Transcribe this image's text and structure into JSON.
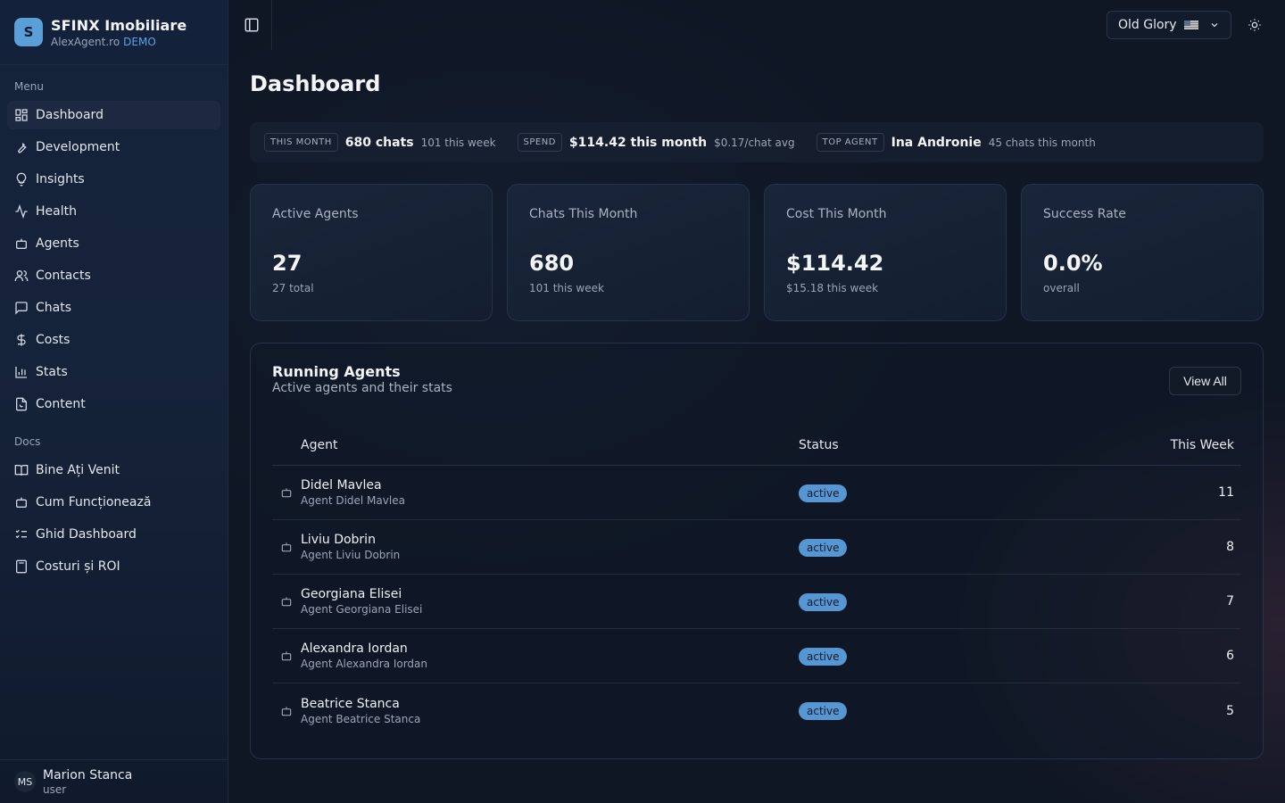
{
  "brand": {
    "initial": "S",
    "name": "SFINX Imobiliare",
    "domain": "AlexAgent.ro",
    "badge": "DEMO"
  },
  "menu": {
    "label": "Menu",
    "items": [
      {
        "label": "Dashboard",
        "icon": "dashboard-icon",
        "active": true
      },
      {
        "label": "Development",
        "icon": "wrench-icon"
      },
      {
        "label": "Insights",
        "icon": "lightbulb-icon"
      },
      {
        "label": "Health",
        "icon": "activity-icon"
      },
      {
        "label": "Agents",
        "icon": "bot-icon"
      },
      {
        "label": "Contacts",
        "icon": "users-icon"
      },
      {
        "label": "Chats",
        "icon": "message-icon"
      },
      {
        "label": "Costs",
        "icon": "dollar-icon"
      },
      {
        "label": "Stats",
        "icon": "bar-chart-icon"
      },
      {
        "label": "Content",
        "icon": "file-icon"
      }
    ]
  },
  "docs": {
    "label": "Docs",
    "items": [
      {
        "label": "Bine Ați Venit",
        "icon": "book-icon"
      },
      {
        "label": "Cum Funcționează",
        "icon": "bot-icon"
      },
      {
        "label": "Ghid Dashboard",
        "icon": "list-checks-icon"
      },
      {
        "label": "Costuri și ROI",
        "icon": "calculator-icon"
      }
    ]
  },
  "user": {
    "initials": "MS",
    "name": "Marion Stanca",
    "role": "user"
  },
  "topbar": {
    "theme": "Old Glory",
    "theme_icon": "flag-icon"
  },
  "page": {
    "title": "Dashboard"
  },
  "summary": {
    "month": {
      "tag": "THIS MONTH",
      "main": "680 chats",
      "sub": "101 this week"
    },
    "spend": {
      "tag": "SPEND",
      "main": "$114.42 this month",
      "sub": "$0.17/chat avg"
    },
    "top_agent": {
      "tag": "TOP AGENT",
      "main": "Ina Andronie",
      "sub": "45 chats this month"
    }
  },
  "cards": [
    {
      "label": "Active Agents",
      "value": "27",
      "sub": "27 total"
    },
    {
      "label": "Chats This Month",
      "value": "680",
      "sub": "101 this week"
    },
    {
      "label": "Cost This Month",
      "value": "$114.42",
      "sub": "$15.18 this week"
    },
    {
      "label": "Success Rate",
      "value": "0.0%",
      "sub": "overall"
    }
  ],
  "running_agents": {
    "title": "Running Agents",
    "subtitle": "Active agents and their stats",
    "view_all": "View All",
    "columns": {
      "agent": "Agent",
      "status": "Status",
      "week": "This Week"
    },
    "rows": [
      {
        "name": "Didel Mavlea",
        "desc": "Agent Didel Mavlea",
        "status": "active",
        "week": "11"
      },
      {
        "name": "Liviu Dobrin",
        "desc": "Agent Liviu Dobrin",
        "status": "active",
        "week": "8"
      },
      {
        "name": "Georgiana Elisei",
        "desc": "Agent Georgiana Elisei",
        "status": "active",
        "week": "7"
      },
      {
        "name": "Alexandra Iordan",
        "desc": "Agent Alexandra Iordan",
        "status": "active",
        "week": "6"
      },
      {
        "name": "Beatrice Stanca",
        "desc": "Agent Beatrice Stanca",
        "status": "active",
        "week": "5"
      }
    ]
  },
  "colors": {
    "accent": "#5a9fd8",
    "badge": "#5596d3",
    "background": "#0f1624",
    "sidebar": "#14213a"
  }
}
